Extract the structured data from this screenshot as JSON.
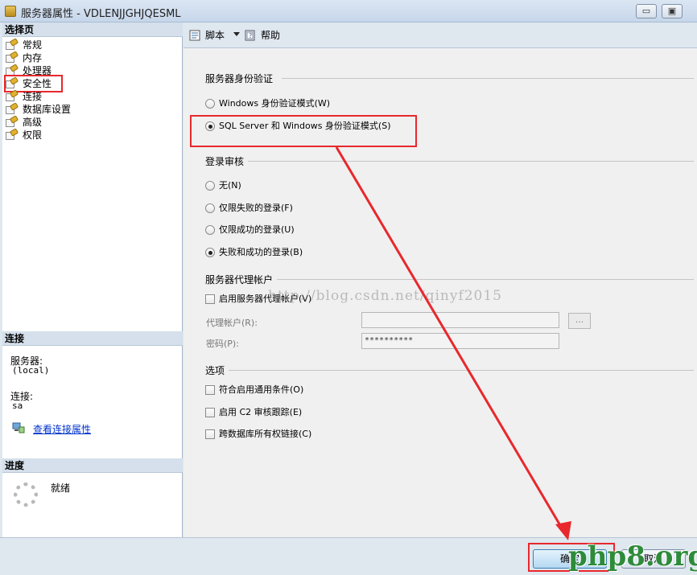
{
  "window": {
    "title": "服务器属性 - VDLENJJGHJQESML",
    "minimize": "▭",
    "maximize": "▣"
  },
  "left": {
    "select_page_header": "选择页",
    "pages": [
      "常规",
      "内存",
      "处理器",
      "安全性",
      "连接",
      "数据库设置",
      "高级",
      "权限"
    ],
    "selected_page": "安全性",
    "connection_header": "连接",
    "server_label": "服务器:",
    "server_value": "(local)",
    "connection_label": "连接:",
    "connection_value": "sa",
    "view_connection_link": "查看连接属性",
    "progress_header": "进度",
    "progress_status": "就绪"
  },
  "toolbar": {
    "script_label": "脚本",
    "help_label": "帮助"
  },
  "auth": {
    "title": "服务器身份验证",
    "windows_mode": "Windows 身份验证模式(W)",
    "mixed_mode": "SQL Server 和 Windows 身份验证模式(S)",
    "selected": "mixed_mode"
  },
  "audit": {
    "title": "登录审核",
    "none": "无(N)",
    "failed_only": "仅限失败的登录(F)",
    "success_only": "仅限成功的登录(U)",
    "both": "失败和成功的登录(B)",
    "selected": "both"
  },
  "proxy": {
    "title": "服务器代理帐户",
    "enable": "启用服务器代理帐户(V)",
    "account_label": "代理帐户(R):",
    "password_label": "密码(P):",
    "password_value": "**********",
    "browse": "..."
  },
  "options": {
    "title": "选项",
    "common_criteria": "符合启用通用条件(O)",
    "c2_audit": "启用 C2 审核跟踪(E)",
    "cross_db_chaining": "跨数据库所有权链接(C)"
  },
  "buttons": {
    "ok": "确定",
    "cancel": "取消"
  },
  "watermark": "http://blog.csdn.net/qinyf2015",
  "overlay_logo": "php8.org",
  "colors": {
    "annotation_red": "#e8282c",
    "logo_green": "#2e8b3a"
  }
}
